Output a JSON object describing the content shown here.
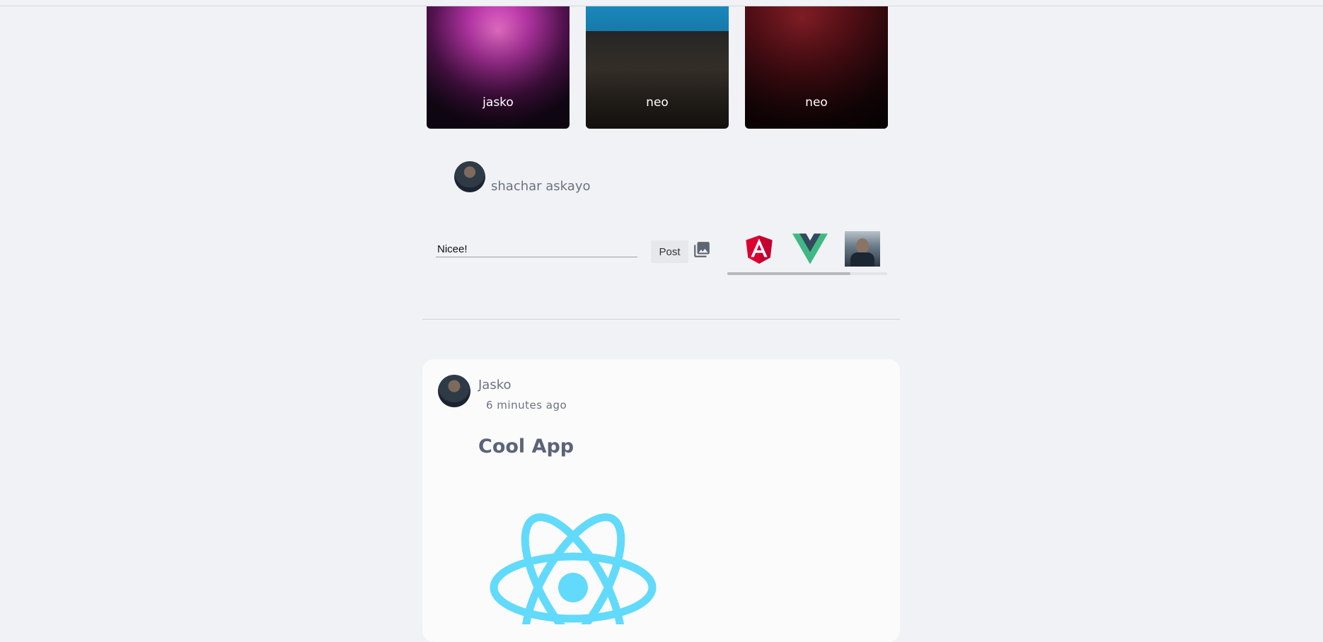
{
  "stories": [
    {
      "name": "jasko"
    },
    {
      "name": "neo"
    },
    {
      "name": "neo"
    }
  ],
  "composer": {
    "user_name": "shachar askayo",
    "input_value": "Nicee!",
    "post_label": "Post",
    "image_picker": [
      "angular-logo",
      "vue-logo",
      "user-photo"
    ],
    "scroll_position": 0.77
  },
  "post": {
    "author": "Jasko",
    "time": "6 minutes ago",
    "title": "Cool App",
    "image": "react-logo"
  },
  "colors": {
    "background": "#f0f2f5",
    "card": "#fbfbfc",
    "muted_text": "#6b7280",
    "title_text": "#5b6378",
    "react": "#61dafb",
    "angular": "#dd1b16",
    "vue_green": "#41b883",
    "vue_dark": "#35495e"
  }
}
